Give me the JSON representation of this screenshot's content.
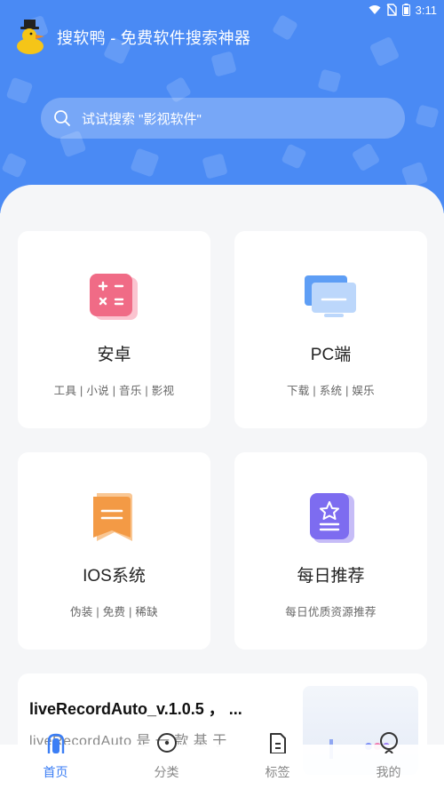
{
  "status_bar": {
    "time": "3:11"
  },
  "app": {
    "title": "搜软鸭 - 免费软件搜索神器",
    "logo": "duck-logo"
  },
  "search": {
    "placeholder": "试试搜索 \"影视软件\""
  },
  "categories": [
    {
      "title": "安卓",
      "subtitle": "工具 | 小说 | 音乐 | 影视",
      "icon": "calculator-icon",
      "color": "#f06b86"
    },
    {
      "title": "PC端",
      "subtitle": "下载 | 系统 | 娱乐",
      "icon": "monitor-icon",
      "color": "#5e9ef5"
    },
    {
      "title": "IOS系统",
      "subtitle": "伪装 | 免费 | 稀缺",
      "icon": "bookmark-icon",
      "color": "#f39a45"
    },
    {
      "title": "每日推荐",
      "subtitle": "每日优质资源推荐",
      "icon": "star-badge-icon",
      "color": "#7d6cf0"
    }
  ],
  "article": {
    "title": "liveRecordAuto_v.1.0.5 ， ...",
    "description": "liveRecordAuto 是 一 款 基 于"
  },
  "bottom_nav": [
    {
      "label": "首页",
      "icon": "home-icon",
      "active": true
    },
    {
      "label": "分类",
      "icon": "category-icon",
      "active": false
    },
    {
      "label": "标签",
      "icon": "tag-icon",
      "active": false
    },
    {
      "label": "我的",
      "icon": "profile-icon",
      "active": false
    }
  ],
  "colors": {
    "header": "#4a8af4",
    "accent": "#3b7ef5"
  }
}
